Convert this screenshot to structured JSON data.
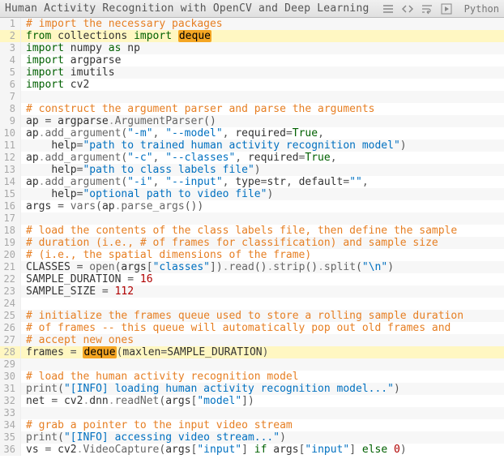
{
  "title": "Human Activity Recognition with OpenCV and Deep Learning",
  "language": "Python",
  "highlight_lines": [
    2,
    28
  ],
  "lines": [
    [
      {
        "t": "# import the necessary packages",
        "c": "cm"
      }
    ],
    [
      {
        "t": "from",
        "c": "kw"
      },
      {
        "t": " collections ",
        "c": "name"
      },
      {
        "t": "import",
        "c": "kw"
      },
      {
        "t": " ",
        "c": "name"
      },
      {
        "t": "deque",
        "c": "mark"
      }
    ],
    [
      {
        "t": "import",
        "c": "kw"
      },
      {
        "t": " numpy ",
        "c": "name"
      },
      {
        "t": "as",
        "c": "kw"
      },
      {
        "t": " np",
        "c": "name"
      }
    ],
    [
      {
        "t": "import",
        "c": "kw"
      },
      {
        "t": " argparse",
        "c": "name"
      }
    ],
    [
      {
        "t": "import",
        "c": "kw"
      },
      {
        "t": " imutils",
        "c": "name"
      }
    ],
    [
      {
        "t": "import",
        "c": "kw"
      },
      {
        "t": " cv2",
        "c": "name"
      }
    ],
    [],
    [
      {
        "t": "# construct the argument parser and parse the arguments",
        "c": "cm"
      }
    ],
    [
      {
        "t": "ap ",
        "c": "name"
      },
      {
        "t": "=",
        "c": "punc"
      },
      {
        "t": " argparse",
        "c": "name"
      },
      {
        "t": ".",
        "c": "dot"
      },
      {
        "t": "ArgumentParser",
        "c": "call"
      },
      {
        "t": "()",
        "c": "punc"
      }
    ],
    [
      {
        "t": "ap",
        "c": "name"
      },
      {
        "t": ".",
        "c": "dot"
      },
      {
        "t": "add_argument",
        "c": "call"
      },
      {
        "t": "(",
        "c": "punc"
      },
      {
        "t": "\"-m\"",
        "c": "str"
      },
      {
        "t": ", ",
        "c": "punc"
      },
      {
        "t": "\"--model\"",
        "c": "str"
      },
      {
        "t": ", ",
        "c": "punc"
      },
      {
        "t": "required",
        "c": "name"
      },
      {
        "t": "=",
        "c": "punc"
      },
      {
        "t": "True",
        "c": "bool"
      },
      {
        "t": ",",
        "c": "punc"
      }
    ],
    [
      {
        "t": "    ",
        "c": "name"
      },
      {
        "t": "help",
        "c": "name"
      },
      {
        "t": "=",
        "c": "punc"
      },
      {
        "t": "\"path to trained human activity recognition model\"",
        "c": "str"
      },
      {
        "t": ")",
        "c": "punc"
      }
    ],
    [
      {
        "t": "ap",
        "c": "name"
      },
      {
        "t": ".",
        "c": "dot"
      },
      {
        "t": "add_argument",
        "c": "call"
      },
      {
        "t": "(",
        "c": "punc"
      },
      {
        "t": "\"-c\"",
        "c": "str"
      },
      {
        "t": ", ",
        "c": "punc"
      },
      {
        "t": "\"--classes\"",
        "c": "str"
      },
      {
        "t": ", ",
        "c": "punc"
      },
      {
        "t": "required",
        "c": "name"
      },
      {
        "t": "=",
        "c": "punc"
      },
      {
        "t": "True",
        "c": "bool"
      },
      {
        "t": ",",
        "c": "punc"
      }
    ],
    [
      {
        "t": "    ",
        "c": "name"
      },
      {
        "t": "help",
        "c": "name"
      },
      {
        "t": "=",
        "c": "punc"
      },
      {
        "t": "\"path to class labels file\"",
        "c": "str"
      },
      {
        "t": ")",
        "c": "punc"
      }
    ],
    [
      {
        "t": "ap",
        "c": "name"
      },
      {
        "t": ".",
        "c": "dot"
      },
      {
        "t": "add_argument",
        "c": "call"
      },
      {
        "t": "(",
        "c": "punc"
      },
      {
        "t": "\"-i\"",
        "c": "str"
      },
      {
        "t": ", ",
        "c": "punc"
      },
      {
        "t": "\"--input\"",
        "c": "str"
      },
      {
        "t": ", ",
        "c": "punc"
      },
      {
        "t": "type",
        "c": "name"
      },
      {
        "t": "=",
        "c": "punc"
      },
      {
        "t": "str",
        "c": "name"
      },
      {
        "t": ", ",
        "c": "punc"
      },
      {
        "t": "default",
        "c": "name"
      },
      {
        "t": "=",
        "c": "punc"
      },
      {
        "t": "\"\"",
        "c": "str"
      },
      {
        "t": ",",
        "c": "punc"
      }
    ],
    [
      {
        "t": "    ",
        "c": "name"
      },
      {
        "t": "help",
        "c": "name"
      },
      {
        "t": "=",
        "c": "punc"
      },
      {
        "t": "\"optional path to video file\"",
        "c": "str"
      },
      {
        "t": ")",
        "c": "punc"
      }
    ],
    [
      {
        "t": "args ",
        "c": "name"
      },
      {
        "t": "=",
        "c": "punc"
      },
      {
        "t": " ",
        "c": "name"
      },
      {
        "t": "vars",
        "c": "call"
      },
      {
        "t": "(",
        "c": "punc"
      },
      {
        "t": "ap",
        "c": "name"
      },
      {
        "t": ".",
        "c": "dot"
      },
      {
        "t": "parse_args",
        "c": "call"
      },
      {
        "t": "())",
        "c": "punc"
      }
    ],
    [],
    [
      {
        "t": "# load the contents of the class labels file, then define the sample",
        "c": "cm"
      }
    ],
    [
      {
        "t": "# duration (i.e., # of frames for classification) and sample size",
        "c": "cm"
      }
    ],
    [
      {
        "t": "# (i.e., the spatial dimensions of the frame)",
        "c": "cm"
      }
    ],
    [
      {
        "t": "CLASSES ",
        "c": "name"
      },
      {
        "t": "=",
        "c": "punc"
      },
      {
        "t": " ",
        "c": "name"
      },
      {
        "t": "open",
        "c": "call"
      },
      {
        "t": "(",
        "c": "punc"
      },
      {
        "t": "args",
        "c": "name"
      },
      {
        "t": "[",
        "c": "punc"
      },
      {
        "t": "\"classes\"",
        "c": "str"
      },
      {
        "t": "])",
        "c": "punc"
      },
      {
        "t": ".",
        "c": "dot"
      },
      {
        "t": "read",
        "c": "call"
      },
      {
        "t": "()",
        "c": "punc"
      },
      {
        "t": ".",
        "c": "dot"
      },
      {
        "t": "strip",
        "c": "call"
      },
      {
        "t": "()",
        "c": "punc"
      },
      {
        "t": ".",
        "c": "dot"
      },
      {
        "t": "split",
        "c": "call"
      },
      {
        "t": "(",
        "c": "punc"
      },
      {
        "t": "\"\\n\"",
        "c": "str"
      },
      {
        "t": ")",
        "c": "punc"
      }
    ],
    [
      {
        "t": "SAMPLE_DURATION ",
        "c": "name"
      },
      {
        "t": "=",
        "c": "punc"
      },
      {
        "t": " ",
        "c": "name"
      },
      {
        "t": "16",
        "c": "num"
      }
    ],
    [
      {
        "t": "SAMPLE_SIZE ",
        "c": "name"
      },
      {
        "t": "=",
        "c": "punc"
      },
      {
        "t": " ",
        "c": "name"
      },
      {
        "t": "112",
        "c": "num"
      }
    ],
    [],
    [
      {
        "t": "# initialize the frames queue used to store a rolling sample duration",
        "c": "cm"
      }
    ],
    [
      {
        "t": "# of frames -- this queue will automatically pop out old frames and",
        "c": "cm"
      }
    ],
    [
      {
        "t": "# accept new ones",
        "c": "cm"
      }
    ],
    [
      {
        "t": "frames ",
        "c": "name"
      },
      {
        "t": "=",
        "c": "punc"
      },
      {
        "t": " ",
        "c": "name"
      },
      {
        "t": "deque",
        "c": "mark"
      },
      {
        "t": "(",
        "c": "punc"
      },
      {
        "t": "maxlen",
        "c": "name"
      },
      {
        "t": "=",
        "c": "punc"
      },
      {
        "t": "SAMPLE_DURATION",
        "c": "name"
      },
      {
        "t": ")",
        "c": "punc"
      }
    ],
    [],
    [
      {
        "t": "# load the human activity recognition model",
        "c": "cm"
      }
    ],
    [
      {
        "t": "print",
        "c": "call"
      },
      {
        "t": "(",
        "c": "punc"
      },
      {
        "t": "\"[INFO] loading human activity recognition model...\"",
        "c": "str"
      },
      {
        "t": ")",
        "c": "punc"
      }
    ],
    [
      {
        "t": "net ",
        "c": "name"
      },
      {
        "t": "=",
        "c": "punc"
      },
      {
        "t": " cv2",
        "c": "name"
      },
      {
        "t": ".",
        "c": "dot"
      },
      {
        "t": "dnn",
        "c": "name"
      },
      {
        "t": ".",
        "c": "dot"
      },
      {
        "t": "readNet",
        "c": "call"
      },
      {
        "t": "(",
        "c": "punc"
      },
      {
        "t": "args",
        "c": "name"
      },
      {
        "t": "[",
        "c": "punc"
      },
      {
        "t": "\"model\"",
        "c": "str"
      },
      {
        "t": "])",
        "c": "punc"
      }
    ],
    [],
    [
      {
        "t": "# grab a pointer to the input video stream",
        "c": "cm"
      }
    ],
    [
      {
        "t": "print",
        "c": "call"
      },
      {
        "t": "(",
        "c": "punc"
      },
      {
        "t": "\"[INFO] accessing video stream...\"",
        "c": "str"
      },
      {
        "t": ")",
        "c": "punc"
      }
    ],
    [
      {
        "t": "vs ",
        "c": "name"
      },
      {
        "t": "=",
        "c": "punc"
      },
      {
        "t": " cv2",
        "c": "name"
      },
      {
        "t": ".",
        "c": "dot"
      },
      {
        "t": "VideoCapture",
        "c": "call"
      },
      {
        "t": "(",
        "c": "punc"
      },
      {
        "t": "args",
        "c": "name"
      },
      {
        "t": "[",
        "c": "punc"
      },
      {
        "t": "\"input\"",
        "c": "str"
      },
      {
        "t": "] ",
        "c": "punc"
      },
      {
        "t": "if",
        "c": "kw"
      },
      {
        "t": " args",
        "c": "name"
      },
      {
        "t": "[",
        "c": "punc"
      },
      {
        "t": "\"input\"",
        "c": "str"
      },
      {
        "t": "] ",
        "c": "punc"
      },
      {
        "t": "else",
        "c": "kw"
      },
      {
        "t": " ",
        "c": "name"
      },
      {
        "t": "0",
        "c": "num"
      },
      {
        "t": ")",
        "c": "punc"
      }
    ]
  ]
}
